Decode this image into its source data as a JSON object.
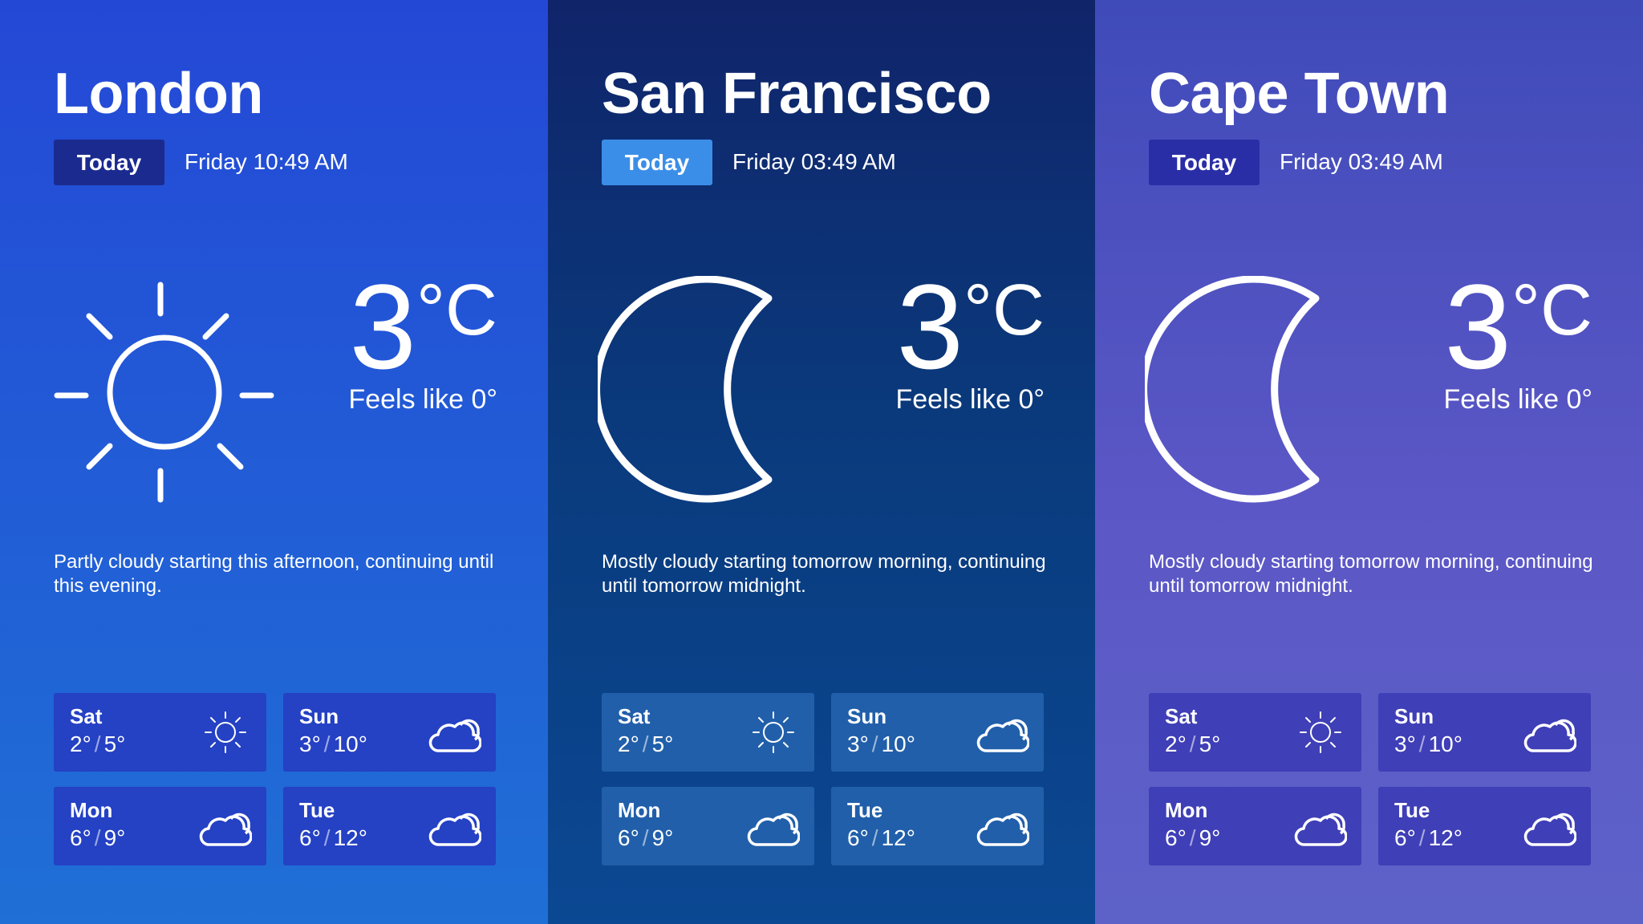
{
  "today_label": "Today",
  "colors": {
    "london_bg": "#2448d6",
    "sf_bg": "#10246a",
    "cape_bg": "#4f52c0",
    "sf_today_button": "#3b8ee8"
  },
  "cities": [
    {
      "name": "London",
      "datetime": "Friday 10:49 AM",
      "icon": "sun-icon",
      "temp": "3",
      "unit": "°C",
      "feels_like": "Feels like 0°",
      "summary": "Partly cloudy starting this afternoon, continuing until this evening.",
      "forecast": [
        {
          "day": "Sat",
          "low": "2°",
          "sep": "/",
          "high": "5°",
          "icon": "sun-icon"
        },
        {
          "day": "Sun",
          "low": "3°",
          "sep": "/",
          "high": "10°",
          "icon": "cloud-icon"
        },
        {
          "day": "Mon",
          "low": "6°",
          "sep": "/",
          "high": "9°",
          "icon": "cloud-icon"
        },
        {
          "day": "Tue",
          "low": "6°",
          "sep": "/",
          "high": "12°",
          "icon": "cloud-icon"
        }
      ]
    },
    {
      "name": "San Francisco",
      "datetime": "Friday 03:49 AM",
      "icon": "moon-icon",
      "temp": "3",
      "unit": "°C",
      "feels_like": "Feels like 0°",
      "summary": "Mostly cloudy starting tomorrow morning, continuing until tomorrow midnight.",
      "forecast": [
        {
          "day": "Sat",
          "low": "2°",
          "sep": "/",
          "high": "5°",
          "icon": "sun-icon"
        },
        {
          "day": "Sun",
          "low": "3°",
          "sep": "/",
          "high": "10°",
          "icon": "cloud-icon"
        },
        {
          "day": "Mon",
          "low": "6°",
          "sep": "/",
          "high": "9°",
          "icon": "cloud-icon"
        },
        {
          "day": "Tue",
          "low": "6°",
          "sep": "/",
          "high": "12°",
          "icon": "cloud-icon"
        }
      ]
    },
    {
      "name": "Cape Town",
      "datetime": "Friday 03:49 AM",
      "icon": "moon-icon",
      "temp": "3",
      "unit": "°C",
      "feels_like": "Feels like 0°",
      "summary": "Mostly cloudy starting tomorrow morning, continuing until tomorrow midnight.",
      "forecast": [
        {
          "day": "Sat",
          "low": "2°",
          "sep": "/",
          "high": "5°",
          "icon": "sun-icon"
        },
        {
          "day": "Sun",
          "low": "3°",
          "sep": "/",
          "high": "10°",
          "icon": "cloud-icon"
        },
        {
          "day": "Mon",
          "low": "6°",
          "sep": "/",
          "high": "9°",
          "icon": "cloud-icon"
        },
        {
          "day": "Tue",
          "low": "6°",
          "sep": "/",
          "high": "12°",
          "icon": "cloud-icon"
        }
      ]
    }
  ]
}
